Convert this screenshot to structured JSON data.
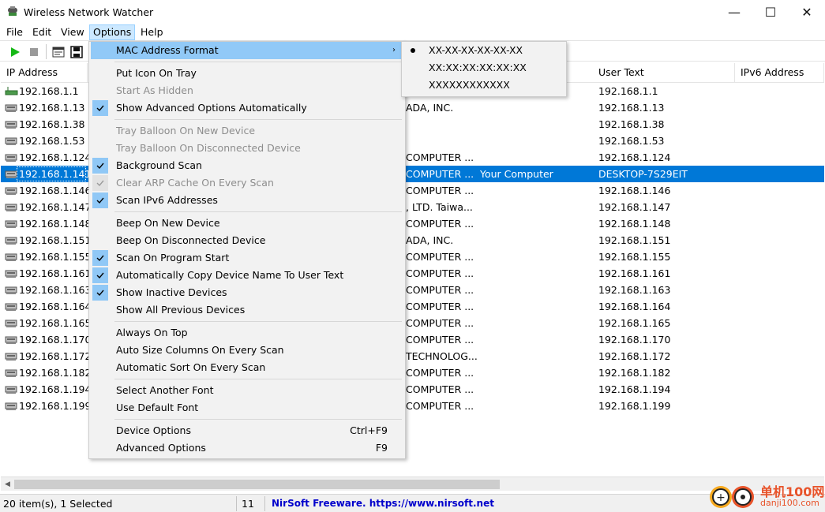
{
  "window": {
    "title": "Wireless Network Watcher",
    "controls": {
      "minimize": "—",
      "maximize": "☐",
      "close": "✕"
    }
  },
  "menubar": {
    "file": "File",
    "edit": "Edit",
    "view": "View",
    "options": "Options",
    "help": "Help"
  },
  "toolbar": {
    "icons": [
      "play-icon",
      "stop-icon",
      "html-report-icon",
      "save-icon"
    ]
  },
  "columns": {
    "ip": "IP Address",
    "user_text": "User Text",
    "ipv6": "IPv6 Address"
  },
  "rows": [
    {
      "ip": "192.168.1.1",
      "mid": "",
      "extra": "",
      "user": "192.168.1.1"
    },
    {
      "ip": "192.168.1.13",
      "mid": "ADA, INC.",
      "extra": "",
      "user": "192.168.1.13"
    },
    {
      "ip": "192.168.1.38",
      "mid": "",
      "extra": "",
      "user": "192.168.1.38"
    },
    {
      "ip": "192.168.1.53",
      "mid": "",
      "extra": "",
      "user": "192.168.1.53"
    },
    {
      "ip": "192.168.1.124",
      "mid": "COMPUTER ...",
      "extra": "",
      "user": "192.168.1.124"
    },
    {
      "ip": "192.168.1.141",
      "mid": "COMPUTER ...",
      "extra": "Your Computer",
      "user": "DESKTOP-7S29EIT"
    },
    {
      "ip": "192.168.1.146",
      "mid": "COMPUTER ...",
      "extra": "",
      "user": "192.168.1.146"
    },
    {
      "ip": "192.168.1.147",
      "mid": ", LTD. Taiwa...",
      "extra": "",
      "user": "192.168.1.147"
    },
    {
      "ip": "192.168.1.148",
      "mid": "COMPUTER ...",
      "extra": "",
      "user": "192.168.1.148"
    },
    {
      "ip": "192.168.1.151",
      "mid": "ADA, INC.",
      "extra": "",
      "user": "192.168.1.151"
    },
    {
      "ip": "192.168.1.155",
      "mid": "COMPUTER ...",
      "extra": "",
      "user": "192.168.1.155"
    },
    {
      "ip": "192.168.1.161",
      "mid": "COMPUTER ...",
      "extra": "",
      "user": "192.168.1.161"
    },
    {
      "ip": "192.168.1.163",
      "mid": "COMPUTER ...",
      "extra": "",
      "user": "192.168.1.163"
    },
    {
      "ip": "192.168.1.164",
      "mid": "COMPUTER ...",
      "extra": "",
      "user": "192.168.1.164"
    },
    {
      "ip": "192.168.1.165",
      "mid": "COMPUTER ...",
      "extra": "",
      "user": "192.168.1.165"
    },
    {
      "ip": "192.168.1.170",
      "mid": "COMPUTER ...",
      "extra": "",
      "user": "192.168.1.170"
    },
    {
      "ip": "192.168.1.172",
      "mid": "TECHNOLOG...",
      "extra": "",
      "user": "192.168.1.172"
    },
    {
      "ip": "192.168.1.182",
      "mid": "COMPUTER ...",
      "extra": "",
      "user": "192.168.1.182"
    },
    {
      "ip": "192.168.1.194",
      "mid": "COMPUTER ...",
      "extra": "",
      "user": "192.168.1.194"
    },
    {
      "ip": "192.168.1.199",
      "mid": "COMPUTER ...",
      "extra": "",
      "user": "192.168.1.199"
    }
  ],
  "selected_row": 5,
  "options_menu": {
    "mac_format": "MAC Address Format",
    "put_icon_on_tray": "Put Icon On Tray",
    "start_as_hidden": "Start As Hidden",
    "show_advanced_auto": "Show Advanced Options Automatically",
    "tray_balloon_new": "Tray Balloon On New Device",
    "tray_balloon_disconnected": "Tray Balloon On Disconnected Device",
    "background_scan": "Background Scan",
    "clear_arp_cache": "Clear ARP Cache On Every Scan",
    "scan_ipv6": "Scan IPv6 Addresses",
    "beep_new": "Beep On New Device",
    "beep_disconnected": "Beep On Disconnected Device",
    "scan_on_start": "Scan On Program Start",
    "auto_copy_name": "Automatically Copy Device Name To User Text",
    "show_inactive": "Show Inactive Devices",
    "show_all_previous": "Show All Previous Devices",
    "always_on_top": "Always On Top",
    "auto_size_columns": "Auto Size Columns On Every Scan",
    "auto_sort": "Automatic Sort On Every Scan",
    "select_font": "Select Another Font",
    "default_font": "Use Default Font",
    "device_options": "Device Options",
    "device_options_shortcut": "Ctrl+F9",
    "advanced_options": "Advanced Options",
    "advanced_options_shortcut": "F9"
  },
  "mac_submenu": {
    "opt1": "XX-XX-XX-XX-XX-XX",
    "opt2": "XX:XX:XX:XX:XX:XX",
    "opt3": "XXXXXXXXXXXX",
    "selected": "XX-XX-XX-XX-XX-XX"
  },
  "status": {
    "items": "20 item(s), 1 Selected",
    "count": "11",
    "link": "NirSoft Freeware. https://www.nirsoft.net"
  },
  "watermark": {
    "site": "单机100网",
    "domain": "danji100.com"
  },
  "colors": {
    "selection": "#0078d7",
    "menu_highlight": "#91c9f7",
    "check_bg": "#90c8f6",
    "link": "#0000cc"
  }
}
